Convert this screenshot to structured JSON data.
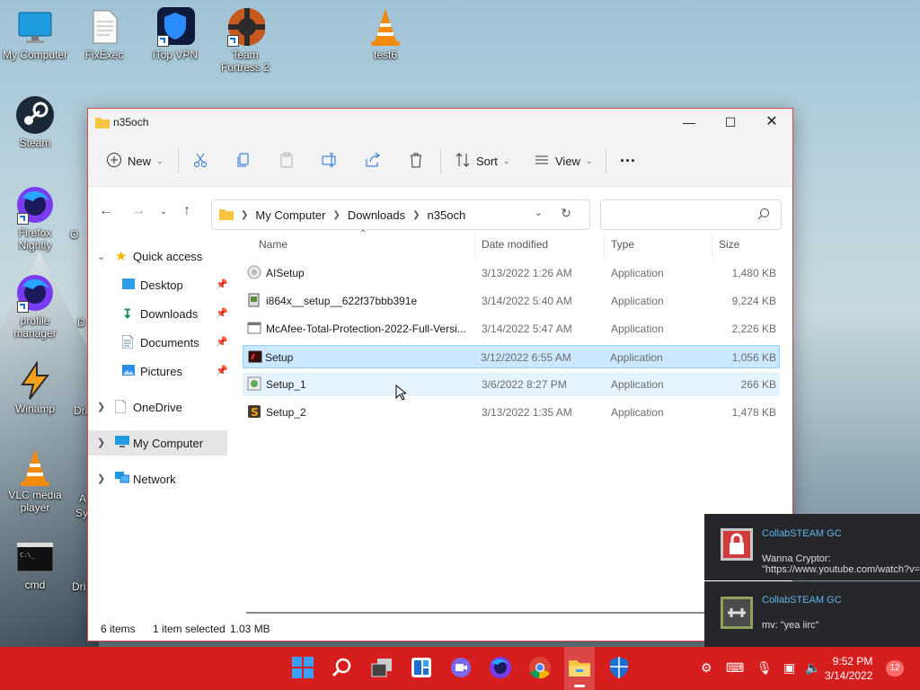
{
  "desktop": {
    "icons": [
      {
        "label": "My Computer",
        "icon": "monitor-icon"
      },
      {
        "label": "FixExec",
        "icon": "document-icon"
      },
      {
        "label": "iTop VPN",
        "icon": "vpn-shield-icon"
      },
      {
        "label": "Team Fortress 2",
        "icon": "tf2-icon"
      },
      {
        "label": "test6",
        "icon": "vlc-cone-icon"
      },
      {
        "label": "Steam",
        "icon": "steam-icon"
      },
      {
        "label": "Firefox Nightly",
        "icon": "firefox-nightly-icon"
      },
      {
        "label": "profile manager",
        "icon": "firefox-icon"
      },
      {
        "label": "Winamp",
        "icon": "winamp-icon"
      },
      {
        "label": "VLC media player",
        "icon": "vlc-cone-icon"
      },
      {
        "label": "cmd",
        "icon": "cmd-icon"
      }
    ],
    "partial_labels": [
      "O",
      "D",
      "Dri",
      "A",
      "Sy",
      "Dri"
    ]
  },
  "window": {
    "title": "n35och",
    "toolbar": {
      "new": "New",
      "sort": "Sort",
      "view": "View",
      "more": "···"
    },
    "address": {
      "path": [
        "My Computer",
        "Downloads",
        "n35och"
      ]
    },
    "search_placeholder": "",
    "nav": {
      "quick_access": "Quick access",
      "desktop": "Desktop",
      "downloads": "Downloads",
      "documents": "Documents",
      "pictures": "Pictures",
      "onedrive": "OneDrive",
      "my_computer": "My Computer",
      "network": "Network"
    },
    "columns": {
      "name": "Name",
      "date": "Date modified",
      "type": "Type",
      "size": "Size"
    },
    "files": [
      {
        "name": "AISetup",
        "date": "3/13/2022 1:26 AM",
        "type": "Application",
        "size": "1,480 KB"
      },
      {
        "name": "i864x__setup__622f37bbb391e",
        "date": "3/14/2022 5:40 AM",
        "type": "Application",
        "size": "9,224 KB"
      },
      {
        "name": "McAfee-Total-Protection-2022-Full-Versi...",
        "date": "3/14/2022 5:47 AM",
        "type": "Application",
        "size": "2,226 KB"
      },
      {
        "name": "Setup",
        "date": "3/12/2022 6:55 AM",
        "type": "Application",
        "size": "1,056 KB"
      },
      {
        "name": "Setup_1",
        "date": "3/6/2022 8:27 PM",
        "type": "Application",
        "size": "266 KB"
      },
      {
        "name": "Setup_2",
        "date": "3/13/2022 1:35 AM",
        "type": "Application",
        "size": "1,478 KB"
      }
    ],
    "status": {
      "count": "6 items",
      "selected": "1 item selected",
      "size": "1.03 MB"
    }
  },
  "notifications": [
    {
      "sender": "CollabSTEAM GC",
      "line1": "Wanna Cryptor:",
      "line2": "\"https://www.youtube.com/watch?v="
    },
    {
      "sender": "CollabSTEAM GC",
      "line1": "mv: \"yea iirc\"",
      "line2": ""
    }
  ],
  "taskbar": {
    "time": "9:52 PM",
    "date": "3/14/2022",
    "badge": "12"
  },
  "colors": {
    "taskbar": "#d61e1e",
    "selection": "#cce8ff",
    "accent": "#0078d4"
  }
}
